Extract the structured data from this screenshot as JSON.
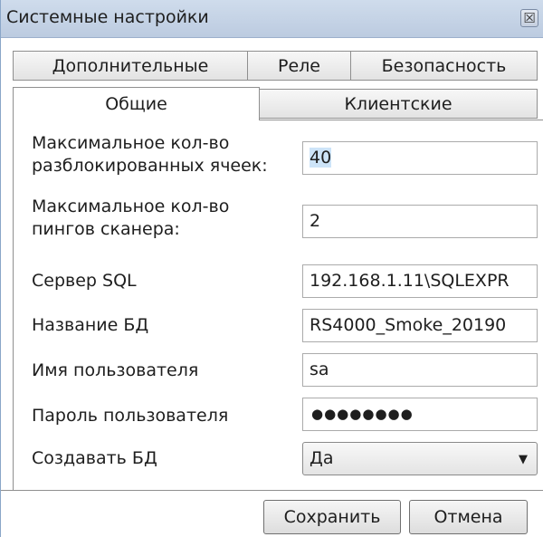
{
  "window": {
    "title": "Системные настройки",
    "close_glyph": "☒"
  },
  "tabs": {
    "row1": [
      "Дополнительные",
      "Реле",
      "Безопасность"
    ],
    "row2": [
      "Общие",
      "Клиентские"
    ],
    "active": "Общие"
  },
  "form": {
    "max_unlocked_label": "Максимальное кол-во\nразблокированных ячеек:",
    "max_unlocked_value": "40",
    "max_pings_label": "Максимальное кол-во\nпингов сканера:",
    "max_pings_value": "2",
    "sql_server_label": "Сервер SQL",
    "sql_server_value": "192.168.1.11\\SQLEXPR",
    "db_name_label": "Название БД",
    "db_name_value": "RS4000_Smoke_20190",
    "username_label": "Имя пользователя",
    "username_value": "sa",
    "password_label": "Пароль пользователя",
    "password_value": "●●●●●●●●",
    "create_db_label": "Создавать БД",
    "create_db_value": "Да",
    "dropdown_arrow": "▼"
  },
  "buttons": {
    "save": "Сохранить",
    "cancel": "Отмена"
  },
  "icons": {
    "close": "close-icon",
    "dropdown": "chevron-down-icon"
  }
}
